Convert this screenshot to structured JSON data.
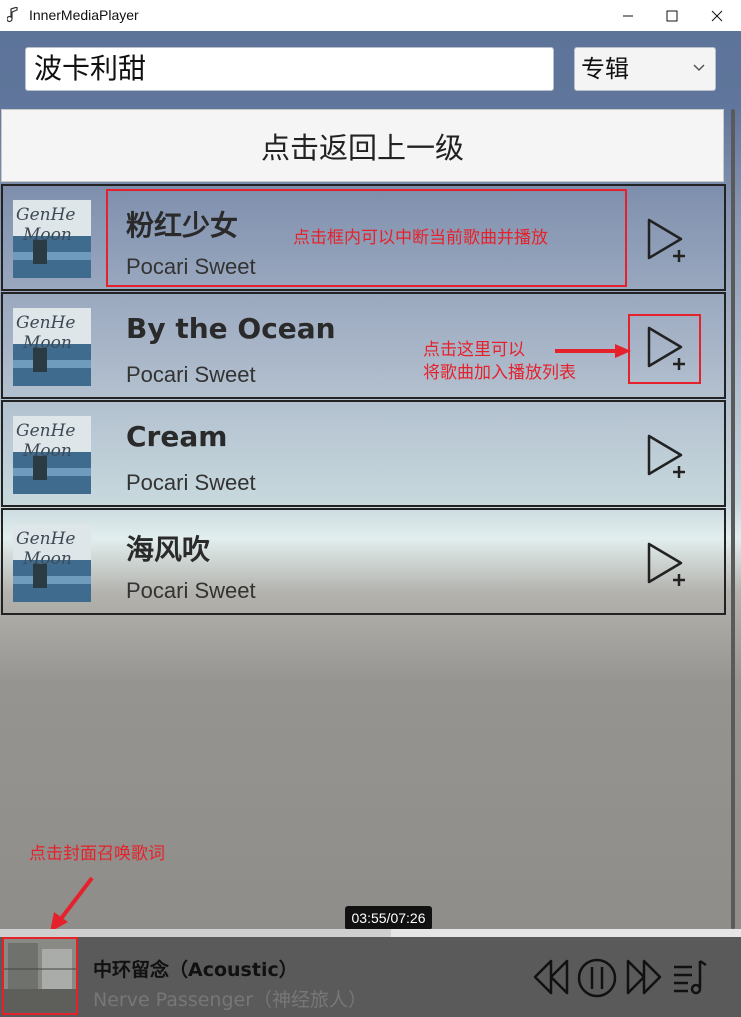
{
  "window": {
    "title": "InnerMediaPlayer",
    "icon": "music-note-icon"
  },
  "search": {
    "value": "波卡利甜",
    "mode_selected": "专辑"
  },
  "back_button": {
    "label": "点击返回上一级"
  },
  "songs": [
    {
      "title": "粉红少女",
      "artist": "Pocari Sweet"
    },
    {
      "title": "By the Ocean",
      "artist": "Pocari Sweet"
    },
    {
      "title": "Cream",
      "artist": "Pocari Sweet"
    },
    {
      "title": "海风吹",
      "artist": "Pocari Sweet"
    }
  ],
  "annotations": {
    "row_click": "点击框内可以中断当前歌曲并播放",
    "add_line1": "点击这里可以",
    "add_line2": "将歌曲加入播放列表",
    "cover_click": "点击封面召唤歌词"
  },
  "player": {
    "time": "03:55/07:26",
    "progress_fraction": 0.527,
    "now_title": "中环留念（Acoustic）",
    "now_artist": "Nerve Passenger（神经旅人）"
  },
  "colors": {
    "accent_annotation": "#e5222b",
    "player_bar": "#5a5a5a"
  }
}
